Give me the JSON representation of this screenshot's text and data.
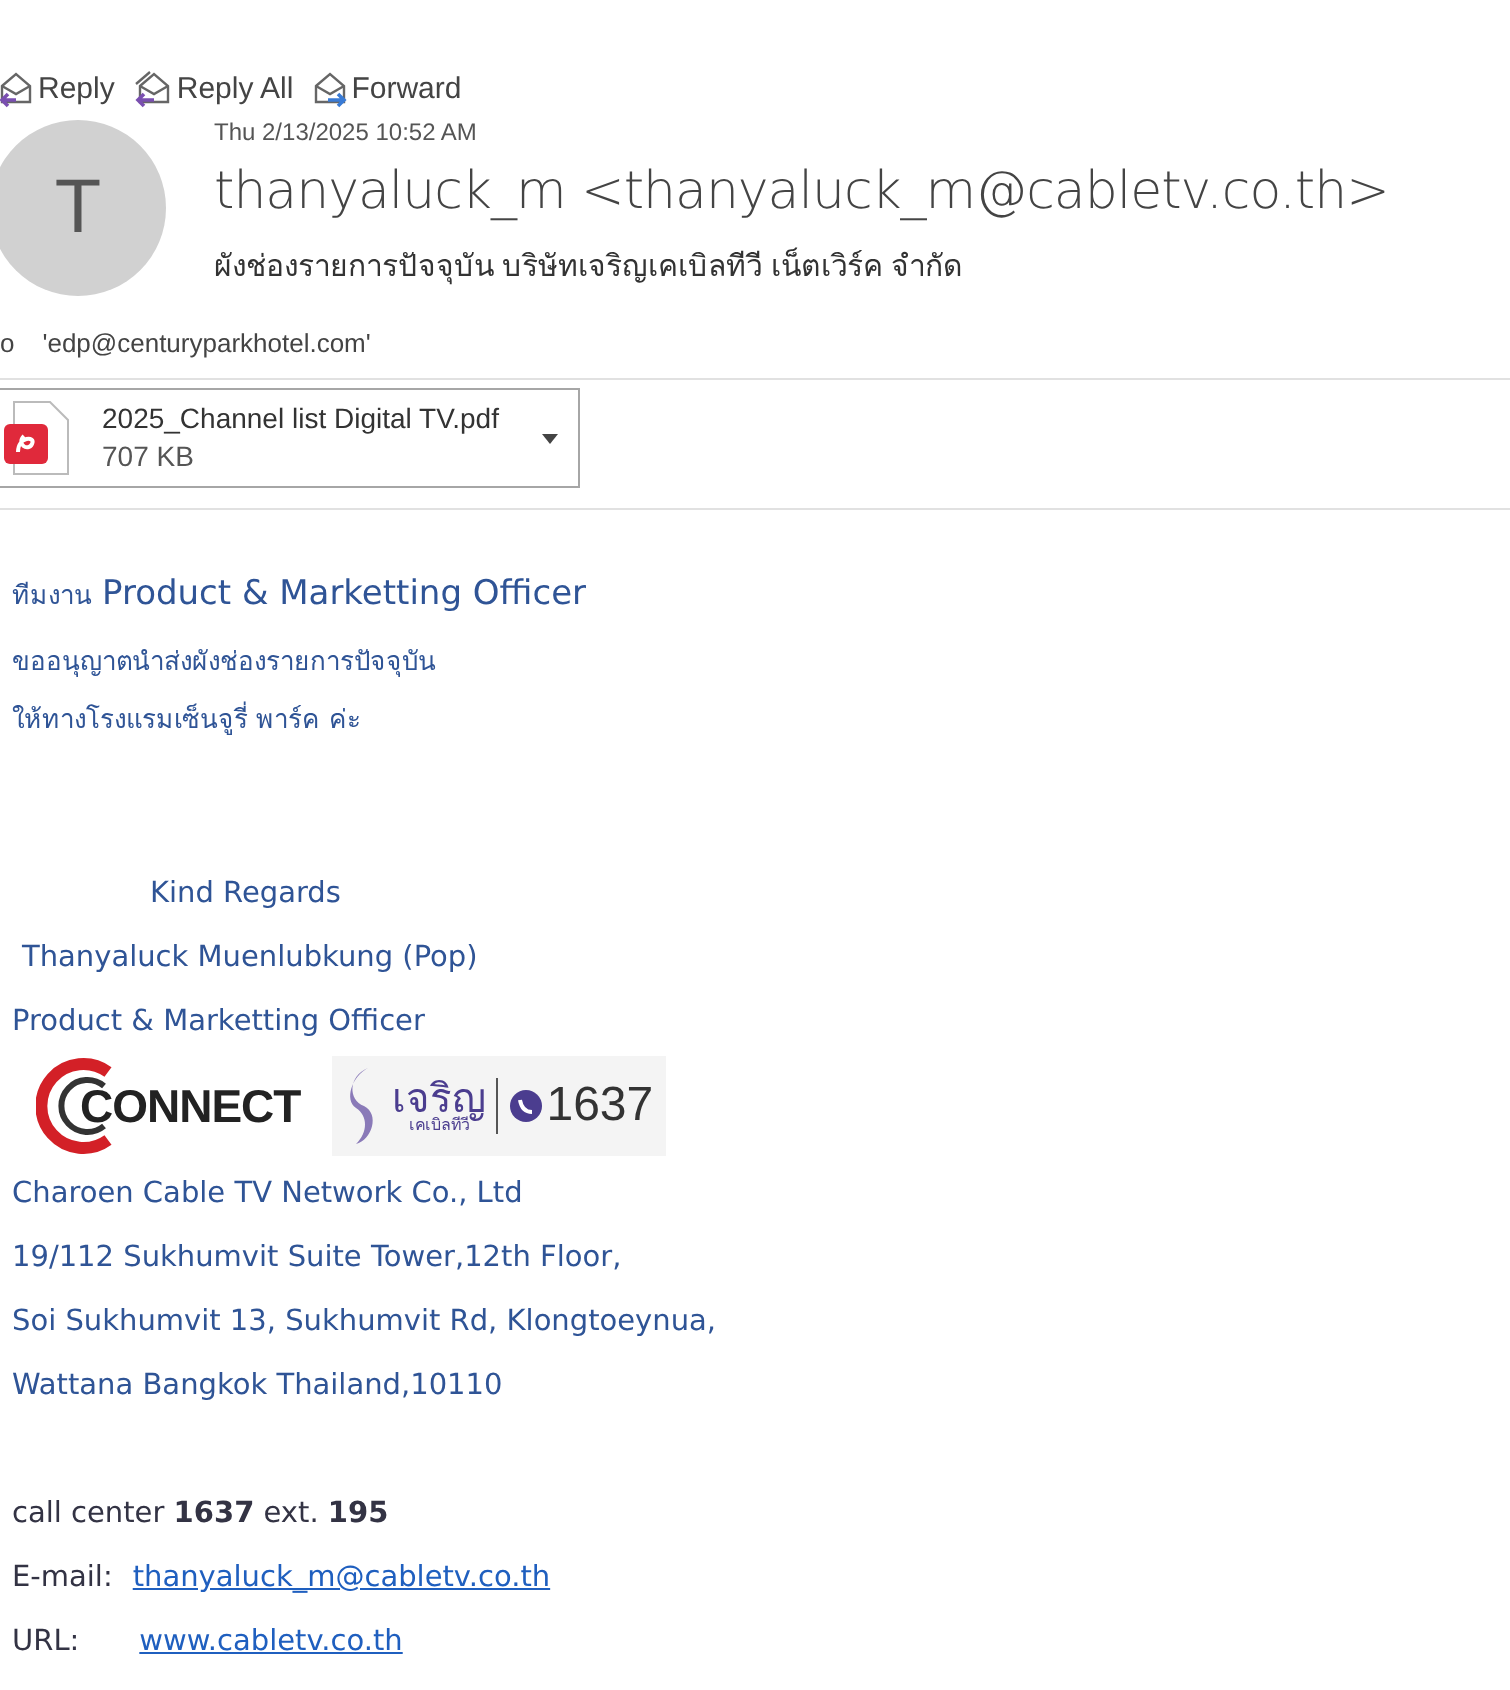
{
  "toolbar": [
    {
      "kind": "reply",
      "label": "Reply"
    },
    {
      "kind": "reply_all",
      "label": "Reply All"
    },
    {
      "kind": "forward",
      "label": "Forward"
    }
  ],
  "header": {
    "avatar_initial": "T",
    "date": "Thu 2/13/2025 10:52 AM",
    "sender": "thanyaluck_m <thanyaluck_m@cabletv.co.th>",
    "subject": "ผังช่องรายการปัจจุบัน บริษัทเจริญเคเบิลทีวี เน็ตเวิร์ค จำกัด",
    "to_label": "o",
    "to": "'edp@centuryparkhotel.com'"
  },
  "attachment": {
    "name": "2025_Channel list Digital TV.pdf",
    "size": "707 KB"
  },
  "body": {
    "greeting_prefix": "ทีมงาน",
    "greeting_team": "Product & Marketting Officer",
    "lines": [
      "ขออนุญาตนำส่งผังช่องรายการปัจจุบัน",
      "ให้ทางโรงแรมเซ็นจูรี่ พาร์ค ค่ะ"
    ]
  },
  "signature": {
    "closing": "Kind Regards",
    "name": "Thanyaluck Muenlubkung (Pop)",
    "title": "Product & Marketting Officer",
    "logos": [
      {
        "kind": "connect",
        "text": "CONNECT"
      },
      {
        "kind": "charoen",
        "text": "เจริญ",
        "subtext": "เคเบิลทีวี",
        "number": "1637"
      }
    ],
    "address": [
      "Charoen Cable TV Network Co., Ltd",
      "19/112 Sukhumvit Suite Tower,12th Floor,",
      "Soi Sukhumvit 13, Sukhumvit Rd, Klongtoeynua,",
      "Wattana Bangkok Thailand,10110"
    ],
    "call_center": "call center **1637** ext. **195**",
    "email_label": "E-mail:",
    "email": "thanyaluck_m@cabletv.co.th",
    "url_label": "URL:",
    "url": "www.cabletv.co.th"
  }
}
